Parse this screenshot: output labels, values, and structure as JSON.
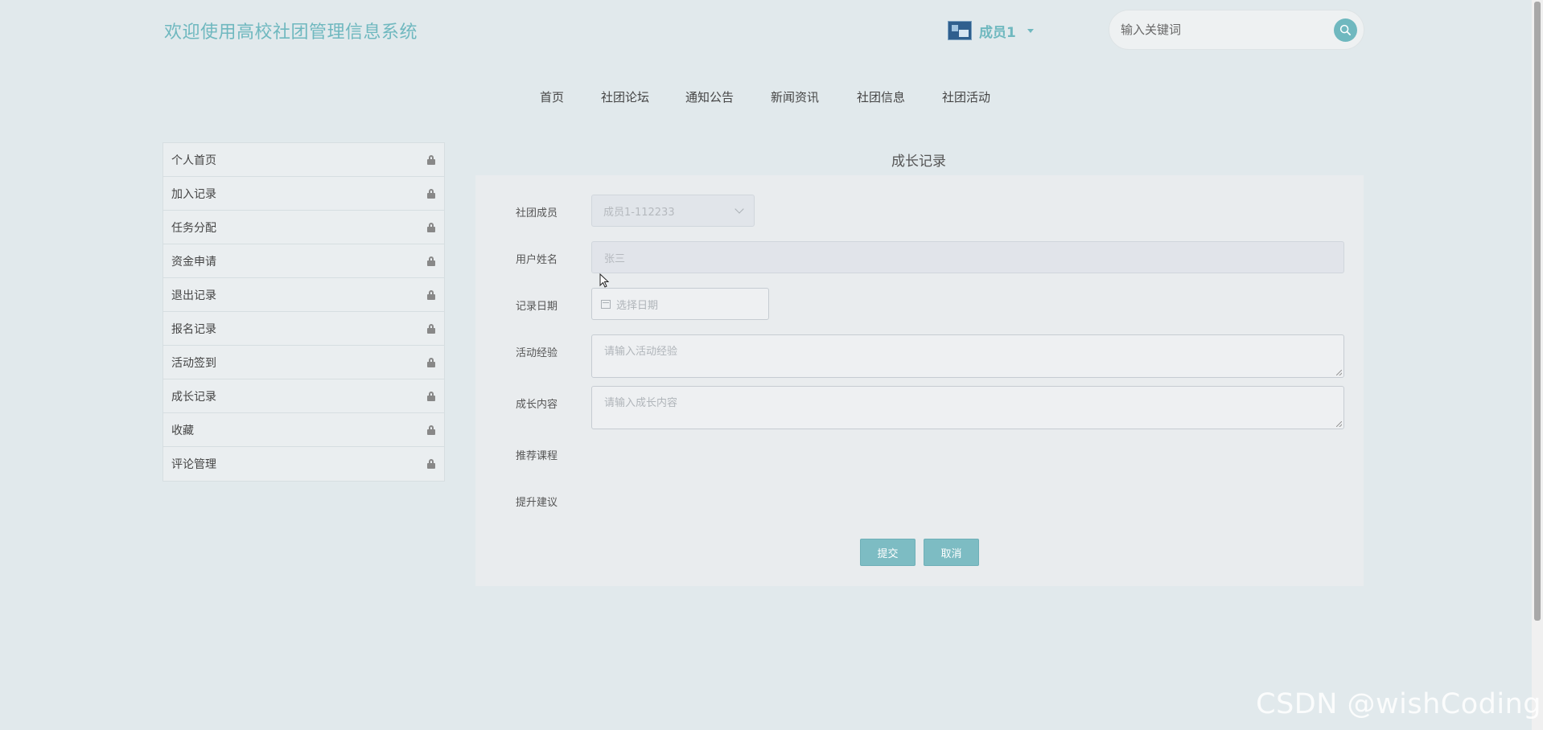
{
  "header": {
    "site_title": "欢迎使用高校社团管理信息系统",
    "user_name": "成员1",
    "search_placeholder": "输入关键词"
  },
  "nav": {
    "items": [
      "首页",
      "社团论坛",
      "通知公告",
      "新闻资讯",
      "社团信息",
      "社团活动"
    ]
  },
  "sidebar": {
    "items": [
      "个人首页",
      "加入记录",
      "任务分配",
      "资金申请",
      "退出记录",
      "报名记录",
      "活动签到",
      "成长记录",
      "收藏",
      "评论管理"
    ]
  },
  "form": {
    "title": "成长记录",
    "member_label": "社团成员",
    "member_value": "成员1-112233",
    "username_label": "用户姓名",
    "username_value": "张三",
    "date_label": "记录日期",
    "date_placeholder": "选择日期",
    "experience_label": "活动经验",
    "experience_placeholder": "请输入活动经验",
    "content_label": "成长内容",
    "content_placeholder": "请输入成长内容",
    "course_label": "推荐课程",
    "advice_label": "提升建议",
    "submit_label": "提交",
    "cancel_label": "取消"
  },
  "watermark": "CSDN @wishCoding",
  "colors": {
    "accent": "#6fb8bf",
    "background": "#e1e9ec",
    "button": "#7dbcc3"
  }
}
